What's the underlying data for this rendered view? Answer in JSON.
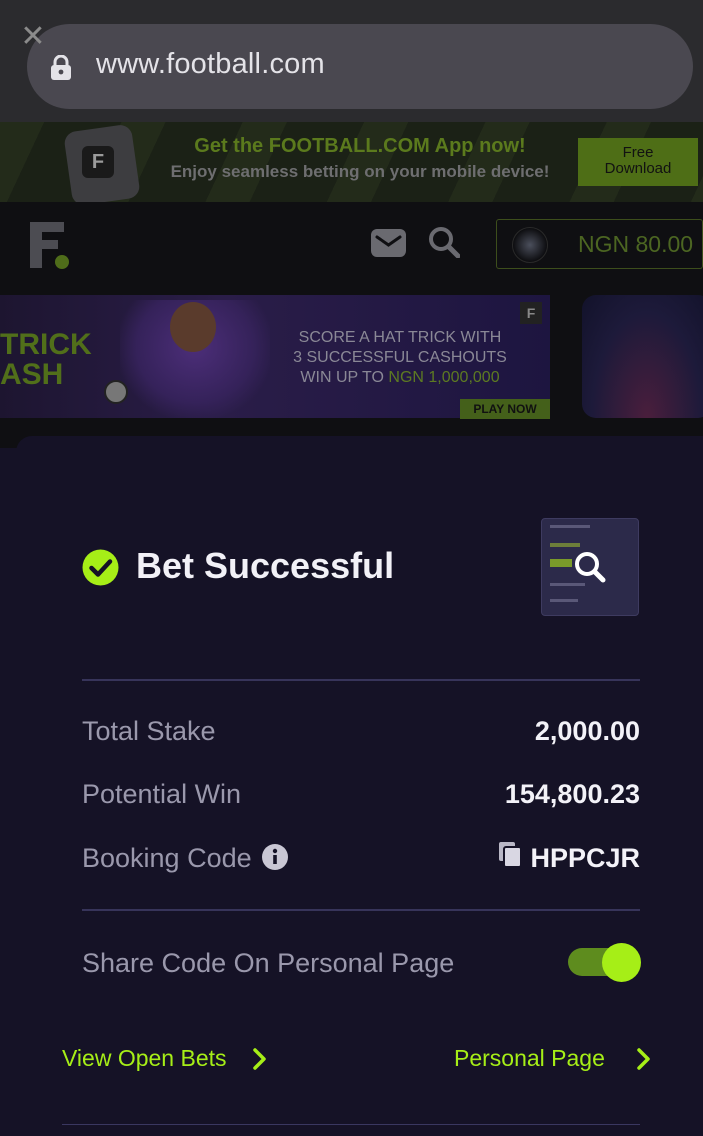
{
  "browser": {
    "url": "www.football.com"
  },
  "promo_bar": {
    "title": "Get the FOOTBALL.COM App now!",
    "subtitle": "Enjoy seamless betting on your mobile device!",
    "button_line1": "Free",
    "button_line2": "Download",
    "close_symbol": "✕"
  },
  "header": {
    "logo_letter": "F",
    "balance": "NGN 80.00"
  },
  "banner": {
    "left_line1": "TRICK",
    "left_line2": "ASH",
    "line1": "SCORE A HAT TRICK WITH",
    "line2": "3 SUCCESSFUL CASHOUTS",
    "line3_prefix": "WIN UP TO ",
    "line3_highlight": "NGN 1,000,000",
    "cta": "PLAY NOW",
    "badge": "F"
  },
  "bet_result": {
    "title": "Bet Successful",
    "rows": [
      {
        "label": "Total Stake",
        "value": "2,000.00"
      },
      {
        "label": "Potential Win",
        "value": "154,800.23"
      },
      {
        "label": "Booking Code",
        "value": "HPPCJR"
      }
    ],
    "share_label": "Share Code On Personal Page",
    "share_enabled": true,
    "view_open_bets": "View Open Bets",
    "personal_page": "Personal Page"
  },
  "colors": {
    "accent": "#a6ee17",
    "sheet_bg": "#151226"
  }
}
